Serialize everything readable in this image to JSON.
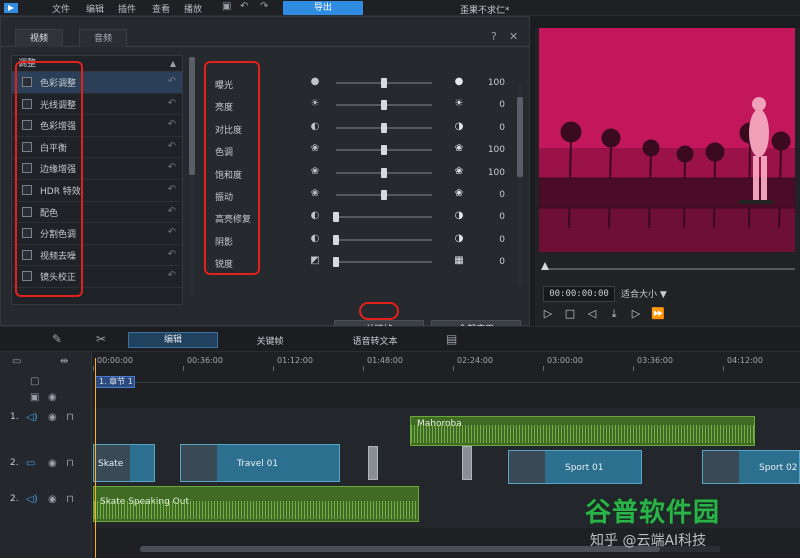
{
  "menu": {
    "items": [
      "文件",
      "编辑",
      "插件",
      "查看",
      "播放"
    ],
    "export_label": "导出",
    "project_title": "歪果不求仁*"
  },
  "panel": {
    "tabs": [
      "视频",
      "音频"
    ],
    "help": "?",
    "close": "✕",
    "list_header": "调整",
    "adjust_items": [
      {
        "label": "色彩调整",
        "selected": true
      },
      {
        "label": "光线调整",
        "selected": false
      },
      {
        "label": "色彩增强",
        "selected": false
      },
      {
        "label": "白平衡",
        "selected": false
      },
      {
        "label": "边缘增强",
        "selected": false
      },
      {
        "label": "HDR 特效",
        "selected": false
      },
      {
        "label": "配色",
        "selected": false
      },
      {
        "label": "分割色调",
        "selected": false
      },
      {
        "label": "视频去噪",
        "selected": false
      },
      {
        "label": "镜头校正",
        "selected": false
      }
    ],
    "sliders": [
      {
        "label": "曝光",
        "icon_left": "●",
        "icon_right": "●",
        "value": "100",
        "level": 0.5
      },
      {
        "label": "亮度",
        "icon_left": "☀",
        "icon_right": "☀",
        "value": "0",
        "level": 0.5
      },
      {
        "label": "对比度",
        "icon_left": "◐",
        "icon_right": "◑",
        "value": "0",
        "level": 0.5
      },
      {
        "label": "色调",
        "icon_left": "❀",
        "icon_right": "❀",
        "value": "100",
        "level": 0.5
      },
      {
        "label": "饱和度",
        "icon_left": "❀",
        "icon_right": "❀",
        "value": "100",
        "level": 0.5
      },
      {
        "label": "振动",
        "icon_left": "❀",
        "icon_right": "❀",
        "value": "0",
        "level": 0.5
      },
      {
        "label": "高亮修复",
        "icon_left": "◐",
        "icon_right": "◑",
        "value": "0",
        "level": 0.0
      },
      {
        "label": "阴影",
        "icon_left": "◐",
        "icon_right": "◑",
        "value": "0",
        "level": 0.0
      },
      {
        "label": "锐度",
        "icon_left": "◩",
        "icon_right": "▦",
        "value": "0",
        "level": 0.0
      }
    ],
    "keyframe_label": "关键帧",
    "apply_all_label": "全部应用"
  },
  "preview": {
    "timecode": "00:00:00:00",
    "fit_label": "适合大小 ▼"
  },
  "edit_bar": {
    "edit_label": "编辑",
    "keyframe_label": "关键帧",
    "stt_label": "语音转文本"
  },
  "timeline": {
    "ruler": [
      "00:00:00",
      "00:36:00",
      "01:12:00",
      "01:48:00",
      "02:24:00",
      "03:00:00",
      "03:36:00",
      "04:12:00"
    ],
    "chapter_label": "1. 章节 1",
    "track_numbers": [
      "1.",
      "2.",
      "2."
    ],
    "clips": {
      "audio_top": "Mahoroba",
      "video_a": "Skate",
      "video_b": "Travel 01",
      "video_c": "Sport 01",
      "video_d": "Sport 02",
      "audio_bottom": "Skate Speaking Out"
    }
  },
  "watermark": {
    "brand": "谷普软件园",
    "zhihu": "知乎 @云端AI科技"
  },
  "colors": {
    "accent": "#2f8ce0",
    "highlight_box": "#e3211c",
    "preview_tint": "#c2185b",
    "audio_clip": "#3f6b24",
    "video_clip": "#2d6f8e",
    "brand_green": "#2bb34a"
  }
}
